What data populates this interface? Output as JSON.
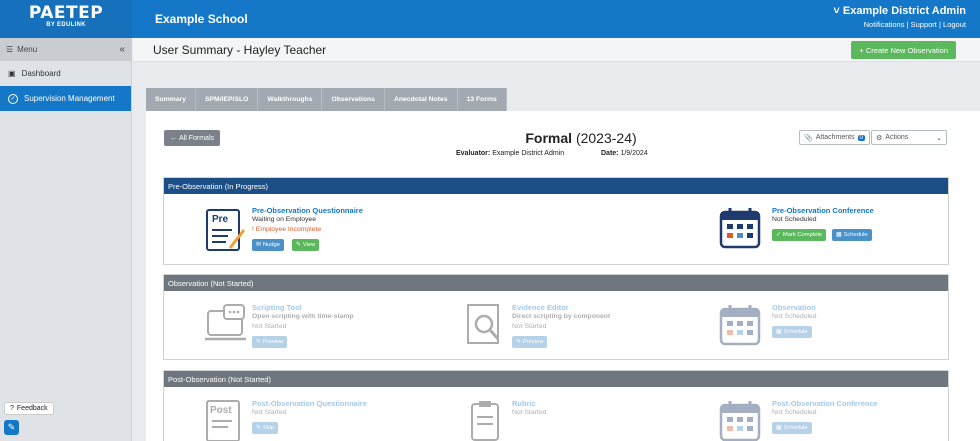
{
  "header": {
    "logo_main": "PAETEP",
    "logo_sub": "BY EDULINK",
    "school": "Example School",
    "admin_name": "Example District Admin",
    "links": [
      "Notifications",
      "Support",
      "Logout"
    ]
  },
  "sidebar": {
    "menu_label": "Menu",
    "items": [
      {
        "label": "Dashboard"
      },
      {
        "label": "Supervision Management"
      }
    ],
    "feedback_label": "Feedback"
  },
  "page": {
    "title": "User Summary - Hayley Teacher",
    "create_button": "+ Create New Observation"
  },
  "tabs": [
    "Summary",
    "SPM/IEP/SLO",
    "Walkthroughs",
    "Observations",
    "Anecdotal Notes",
    "13 Forms"
  ],
  "formal": {
    "back_button": "All Formals",
    "title": "Formal",
    "year": "(2023-24)",
    "evaluator_label": "Evaluator:",
    "evaluator_value": "Example District Admin",
    "date_label": "Date:",
    "date_value": "1/9/2024",
    "attachments_label": "Attachments",
    "attachments_count": "0",
    "actions_label": "Actions"
  },
  "sections": {
    "pre": {
      "title": "Pre-Observation (In Progress)",
      "questionnaire": {
        "icon_text": "Pre",
        "title": "Pre-Observation Questionnaire",
        "status": "Waiting on Employee",
        "warning": "Employee Incomplete",
        "btn_nudge": "Nudge",
        "btn_view": "View"
      },
      "conference": {
        "title": "Pre-Observation Conference",
        "status": "Not Scheduled",
        "btn_mark": "Mark Complete",
        "btn_schedule": "Schedule"
      }
    },
    "obs": {
      "title": "Observation (Not Started)",
      "scripting": {
        "title": "Scripting Tool",
        "desc": "Open scripting with time-stamp",
        "status": "Not Started",
        "btn": "Preview"
      },
      "evidence": {
        "title": "Evidence Editor",
        "desc": "Direct scripting by component",
        "status": "Not Started",
        "btn": "Preview"
      },
      "observation": {
        "title": "Observation",
        "status": "Not Scheduled",
        "btn": "Schedule"
      }
    },
    "post": {
      "title": "Post-Observation (Not Started)",
      "questionnaire": {
        "icon_text": "Post",
        "title": "Post-Observation Questionnaire",
        "status": "Not Started",
        "btn": "Skip"
      },
      "rubric": {
        "title": "Rubric",
        "status": "Not Started"
      },
      "conference": {
        "title": "Post-Observation Conference",
        "status": "Not Scheduled",
        "btn": "Schedule"
      }
    }
  },
  "colors": {
    "brand_blue": "#1577c7",
    "navy_header": "#1b4f86",
    "gray_header": "#6f767d",
    "green": "#5cb85c",
    "warning": "#e05a2a"
  }
}
